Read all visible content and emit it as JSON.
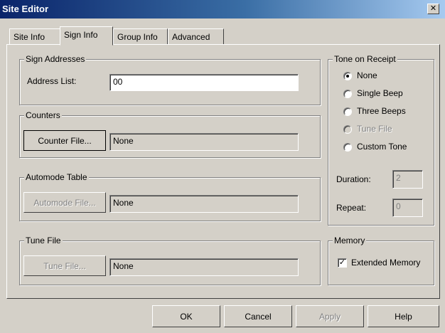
{
  "window": {
    "title": "Site Editor",
    "close_glyph": "✕"
  },
  "tabs": [
    {
      "label": "Site Info",
      "active": false
    },
    {
      "label": "Sign Info",
      "active": true
    },
    {
      "label": "Group Info",
      "active": false
    },
    {
      "label": "Advanced",
      "active": false
    }
  ],
  "sign_addresses": {
    "group_title": "Sign Addresses",
    "address_label": "Address List:",
    "address_value": "00"
  },
  "counters": {
    "group_title": "Counters",
    "button_label": "Counter File...",
    "value": "None"
  },
  "automode": {
    "group_title": "Automode Table",
    "button_label": "Automode File...",
    "value": "None"
  },
  "tune_file": {
    "group_title": "Tune File",
    "button_label": "Tune File...",
    "value": "None"
  },
  "tone_on_receipt": {
    "group_title": "Tone on Receipt",
    "options": [
      {
        "label": "None",
        "selected": true,
        "enabled": true
      },
      {
        "label": "Single Beep",
        "selected": false,
        "enabled": true
      },
      {
        "label": "Three Beeps",
        "selected": false,
        "enabled": true
      },
      {
        "label": "Tune File",
        "selected": false,
        "enabled": false
      },
      {
        "label": "Custom Tone",
        "selected": false,
        "enabled": true
      }
    ],
    "duration_label": "Duration:",
    "duration_value": "2",
    "repeat_label": "Repeat:",
    "repeat_value": "0"
  },
  "memory": {
    "group_title": "Memory",
    "checkbox_label": "Extended Memory",
    "checked": true,
    "check_glyph": "✓"
  },
  "footer": {
    "ok_label": "OK",
    "cancel_label": "Cancel",
    "apply_label": "Apply",
    "help_label": "Help"
  }
}
